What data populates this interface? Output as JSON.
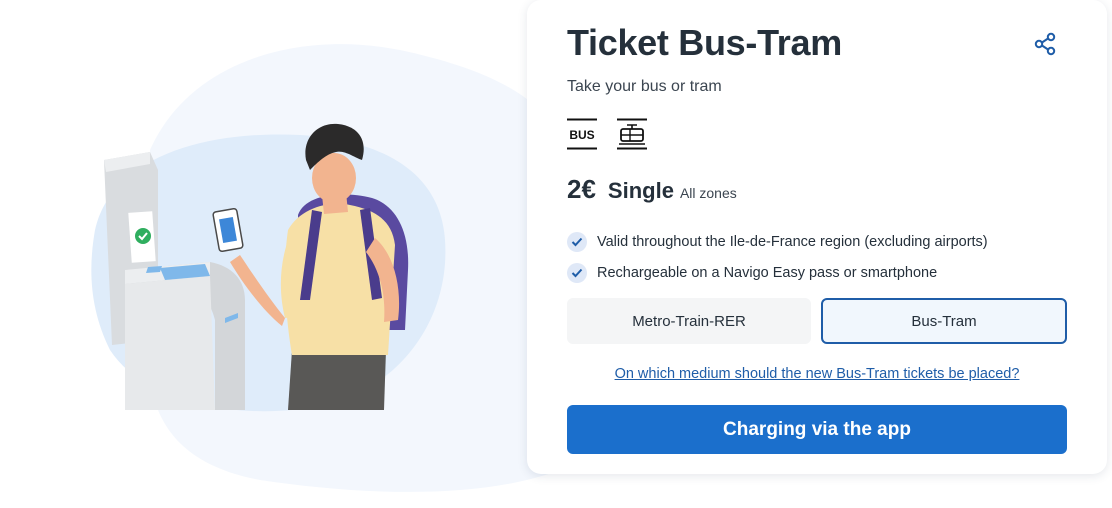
{
  "ticket": {
    "title": "Ticket Bus-Tram",
    "subtitle": "Take your bus or tram",
    "price": "2€",
    "type": "Single",
    "zones": "All zones"
  },
  "modes": [
    {
      "icon": "bus-icon",
      "label": "BUS"
    },
    {
      "icon": "tram-icon"
    }
  ],
  "features": [
    "Valid throughout the Ile-de-France region (excluding airports)",
    "Rechargeable on a Navigo Easy pass or smartphone"
  ],
  "toggle": {
    "options": [
      "Metro-Train-RER",
      "Bus-Tram"
    ],
    "selected": "Bus-Tram"
  },
  "help_link": "On which medium should the new Bus-Tram tickets be placed?",
  "cta_label": "Charging via the app",
  "colors": {
    "accent": "#1b6fcc",
    "selected_border": "#1f5da8",
    "text": "#25303b",
    "check_bg": "#dfe8f7"
  }
}
